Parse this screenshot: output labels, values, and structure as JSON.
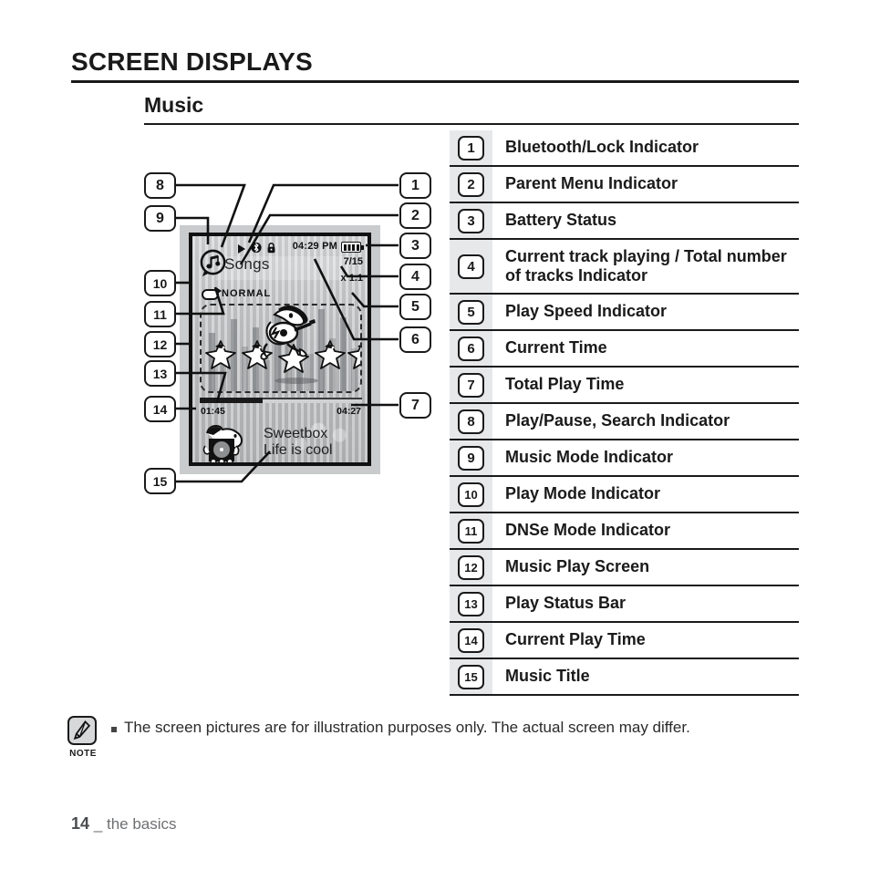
{
  "header": {
    "title": "SCREEN DISPLAYS",
    "section": "Music"
  },
  "legend": {
    "items": [
      {
        "num": "1",
        "label": "Bluetooth/Lock Indicator"
      },
      {
        "num": "2",
        "label": "Parent Menu Indicator"
      },
      {
        "num": "3",
        "label": "Battery Status"
      },
      {
        "num": "4",
        "label": "Current track playing / Total number of tracks Indicator"
      },
      {
        "num": "5",
        "label": "Play Speed Indicator"
      },
      {
        "num": "6",
        "label": "Current Time"
      },
      {
        "num": "7",
        "label": "Total Play Time"
      },
      {
        "num": "8",
        "label": "Play/Pause, Search Indicator"
      },
      {
        "num": "9",
        "label": "Music Mode Indicator"
      },
      {
        "num": "10",
        "label": "Play Mode Indicator"
      },
      {
        "num": "11",
        "label": "DNSe Mode Indicator"
      },
      {
        "num": "12",
        "label": "Music Play Screen"
      },
      {
        "num": "13",
        "label": "Play Status Bar"
      },
      {
        "num": "14",
        "label": "Current Play Time"
      },
      {
        "num": "15",
        "label": "Music Title"
      }
    ]
  },
  "callouts": {
    "left": [
      "8",
      "9",
      "10",
      "11",
      "12",
      "13",
      "14",
      "15"
    ],
    "right": [
      "1",
      "2",
      "3",
      "4",
      "5",
      "6",
      "7"
    ]
  },
  "device_screen": {
    "parent_menu": "Songs",
    "clock": "04:29 PM",
    "track_counter": "7/15",
    "play_speed": "x 1.1",
    "play_mode": "NORMAL",
    "current_play_time": "01:45",
    "total_play_time": "04:27",
    "music_title_line1": "Sweetbox",
    "music_title_line2": "Life is cool",
    "icons": {
      "play": "play-icon",
      "bluetooth": "bluetooth-icon",
      "lock": "lock-icon",
      "battery": "battery-icon",
      "music_mode": "music-note-icon",
      "repeat": "repeat-icon"
    },
    "progress_percent": 39
  },
  "note": {
    "icon_label": "NOTE",
    "text": "The screen pictures are for illustration purposes only. The actual screen may differ."
  },
  "footer": {
    "page_number": "14",
    "separator": "_",
    "chapter": "the basics"
  },
  "colors": {
    "ink": "#1a1a1a",
    "legend_numcell_bg": "#e6e8ea",
    "footer_text": "#6d6f72"
  }
}
